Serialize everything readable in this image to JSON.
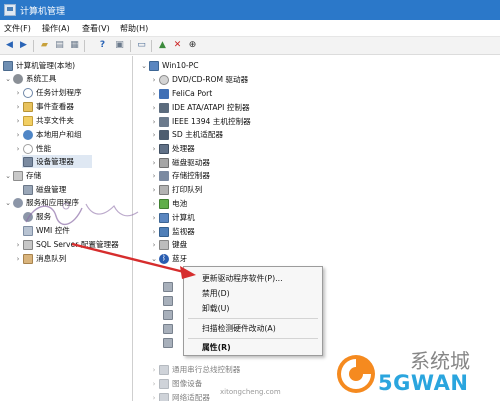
{
  "window": {
    "title": "计算机管理"
  },
  "menu": {
    "items": [
      "文件(F)",
      "操作(A)",
      "查看(V)",
      "帮助(H)"
    ]
  },
  "toolbar": {
    "back_icon": "arrow-left-icon",
    "forward_icon": "arrow-right-icon",
    "up_icon": "folder-up-icon",
    "properties_icon": "properties-icon",
    "help_icon": "help-icon",
    "show_hide_icon": "show-hide-tree-icon",
    "scan_icon": "scan-hardware-icon",
    "add_icon": "add-driver-icon",
    "delete_icon": "delete-icon",
    "update_icon": "download-icon"
  },
  "left_tree": [
    {
      "label": "计算机管理(本地)",
      "icon": "computer-icon"
    },
    {
      "label": "系统工具",
      "icon": "tools-icon"
    },
    {
      "label": "任务计划程序",
      "icon": "clock-icon"
    },
    {
      "label": "事件查看器",
      "icon": "log-icon"
    },
    {
      "label": "共享文件夹",
      "icon": "folder-icon"
    },
    {
      "label": "本地用户和组",
      "icon": "users-icon"
    },
    {
      "label": "性能",
      "icon": "performance-icon"
    },
    {
      "label": "设备管理器",
      "icon": "device-manager-icon"
    },
    {
      "label": "存储",
      "icon": "storage-icon"
    },
    {
      "label": "磁盘管理",
      "icon": "disk-icon"
    },
    {
      "label": "服务和应用程序",
      "icon": "services-icon"
    },
    {
      "label": "服务",
      "icon": "service-icon"
    },
    {
      "label": "WMI 控件",
      "icon": "wmi-icon"
    },
    {
      "label": "SQL Server 配置管理器",
      "icon": "sql-icon"
    },
    {
      "label": "消息队列",
      "icon": "queue-icon"
    }
  ],
  "right_tree": {
    "root": "Win10-PC",
    "items": [
      {
        "label": "DVD/CD-ROM 驱动器",
        "icon": "dvd-icon"
      },
      {
        "label": "FeliCa Port",
        "icon": "felica-icon"
      },
      {
        "label": "IDE ATA/ATAPI 控制器",
        "icon": "ide-icon"
      },
      {
        "label": "IEEE 1394 主机控制器",
        "icon": "ieee1394-icon"
      },
      {
        "label": "SD 主机适配器",
        "icon": "sd-icon"
      },
      {
        "label": "处理器",
        "icon": "cpu-icon"
      },
      {
        "label": "磁盘驱动器",
        "icon": "hdd-icon"
      },
      {
        "label": "存储控制器",
        "icon": "storage-controller-icon"
      },
      {
        "label": "打印队列",
        "icon": "print-icon"
      },
      {
        "label": "电池",
        "icon": "battery-icon"
      },
      {
        "label": "计算机",
        "icon": "pc-icon"
      },
      {
        "label": "监视器",
        "icon": "monitor-icon"
      },
      {
        "label": "键盘",
        "icon": "keyboard-icon"
      },
      {
        "label": "蓝牙",
        "icon": "bluetooth-icon"
      }
    ],
    "faded_items": [
      {
        "label": "通用串行总线控制器",
        "icon": "usb-icon"
      },
      {
        "label": "图像设备",
        "icon": "camera-icon"
      },
      {
        "label": "网络适配器",
        "icon": "network-icon"
      }
    ]
  },
  "context_menu": {
    "items": [
      "更新驱动程序软件(P)...",
      "禁用(D)",
      "卸载(U)",
      "扫描检测硬件改动(A)",
      "属性(R)"
    ]
  },
  "watermark": {
    "brand": "5GWAN",
    "cn": "系统城",
    "site": "xitongcheng.com"
  },
  "colors": {
    "title_bar": "#2b78c9",
    "selection": "#dfe8f3",
    "annotation_arrow": "#d62d2d",
    "brand": "#2aa5de"
  }
}
